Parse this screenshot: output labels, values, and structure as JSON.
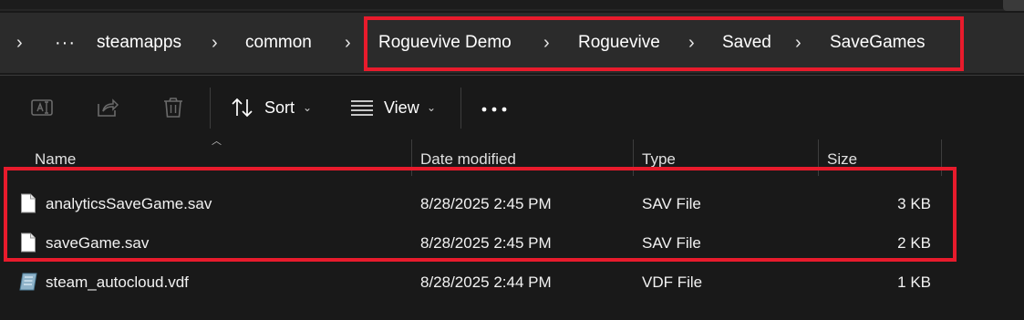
{
  "breadcrumb": {
    "items": [
      "steamapps",
      "common",
      "Roguevive Demo",
      "Roguevive",
      "Saved",
      "SaveGames"
    ]
  },
  "toolbar": {
    "sort_label": "Sort",
    "view_label": "View",
    "icons": [
      "rename-icon",
      "share-icon",
      "delete-icon",
      "sort-icon",
      "view-icon",
      "more-icon"
    ]
  },
  "columns": [
    "Name",
    "Date modified",
    "Type",
    "Size"
  ],
  "files": [
    {
      "name": "analyticsSaveGame.sav",
      "date": "8/28/2025 2:45 PM",
      "type": "SAV File",
      "size": "3 KB",
      "icon": "file-icon"
    },
    {
      "name": "saveGame.sav",
      "date": "8/28/2025 2:45 PM",
      "type": "SAV File",
      "size": "2 KB",
      "icon": "file-icon"
    },
    {
      "name": "steam_autocloud.vdf",
      "date": "8/28/2025 2:44 PM",
      "type": "VDF File",
      "size": "1 KB",
      "icon": "vdf-file-icon"
    }
  ],
  "annotations": {
    "highlight_color": "#e81b2c"
  }
}
